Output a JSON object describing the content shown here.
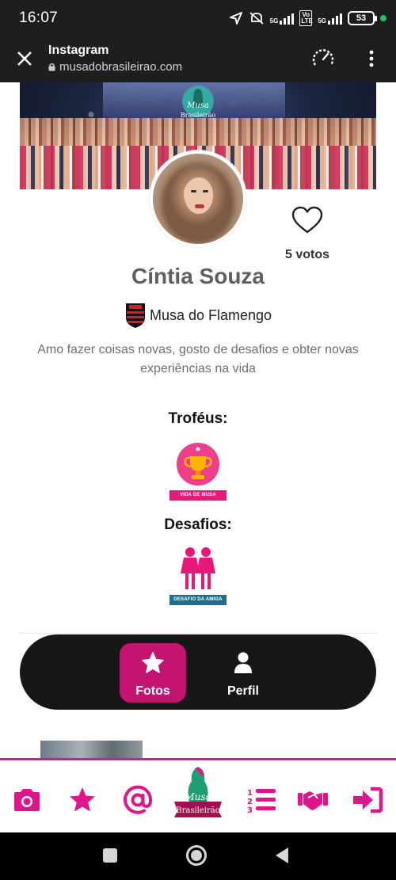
{
  "status_bar": {
    "time": "16:07",
    "network_1": "5G",
    "network_2": "5G",
    "volte": "Vo LTE",
    "battery": "53"
  },
  "browser": {
    "title": "Instagram",
    "url": "musadobrasileirao.com"
  },
  "banner": {
    "logo_text_1": "Musa",
    "logo_text_2": "Brasileirão"
  },
  "profile": {
    "name": "Cíntia Souza",
    "team": "Musa do Flamengo",
    "bio": "Amo fazer coisas novas, gosto de desafios e obter novas experiências na vida",
    "votes": "5 votos"
  },
  "trophies": {
    "title": "Troféus:",
    "badge_label": "VIDA DE MUSA"
  },
  "challenges": {
    "title": "Desafios:",
    "badge_label": "DESAFIO DA AMIGA"
  },
  "tabs": [
    {
      "label": "Fotos",
      "active": true
    },
    {
      "label": "Perfil",
      "active": false
    }
  ],
  "bottom_nav": {
    "items": [
      "camera-icon",
      "star-icon",
      "at-icon",
      "logo",
      "ranking-list-icon",
      "handshake-icon",
      "login-icon"
    ],
    "logo_text_1": "Musa",
    "logo_text_2": "Brasileirão",
    "accent": "#e0148b"
  },
  "colors": {
    "accent": "#c4146f",
    "tab_bar": "#171717",
    "nav_pink": "#e0148b"
  }
}
